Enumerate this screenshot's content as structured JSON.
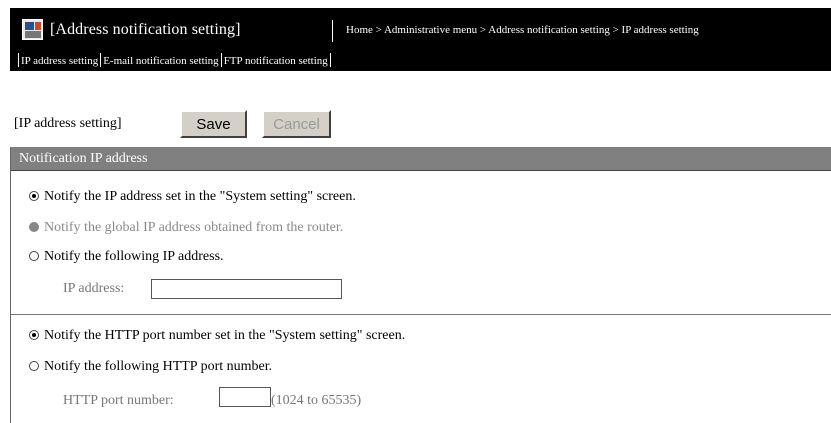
{
  "header": {
    "title": "[Address notification setting]",
    "breadcrumb": "Home > Administrative menu > Address notification setting > IP address setting"
  },
  "subnav": {
    "tabs": [
      {
        "label": "IP address setting"
      },
      {
        "label": "E-mail notification setting"
      },
      {
        "label": "FTP notification setting"
      }
    ]
  },
  "page": {
    "section_label": "[IP address setting]",
    "save_label": "Save",
    "cancel_label": "Cancel"
  },
  "notification_ip": {
    "header": "Notification IP address",
    "options": [
      {
        "label": "Notify the IP address set in the \"System setting\" screen.",
        "selected": true,
        "enabled": true
      },
      {
        "label": "Notify the global IP address obtained from the router.",
        "selected": false,
        "enabled": false
      },
      {
        "label": "Notify the following IP address.",
        "selected": false,
        "enabled": true
      }
    ],
    "ip_field": {
      "label": "IP address:",
      "value": ""
    }
  },
  "http_port": {
    "options": [
      {
        "label": "Notify the HTTP port number set in the \"System setting\" screen.",
        "selected": true,
        "enabled": true
      },
      {
        "label": "Notify the following HTTP port number.",
        "selected": false,
        "enabled": true
      }
    ],
    "port_field": {
      "label": "HTTP port number:",
      "value": "",
      "range_hint": "(1024 to 65535)"
    }
  }
}
